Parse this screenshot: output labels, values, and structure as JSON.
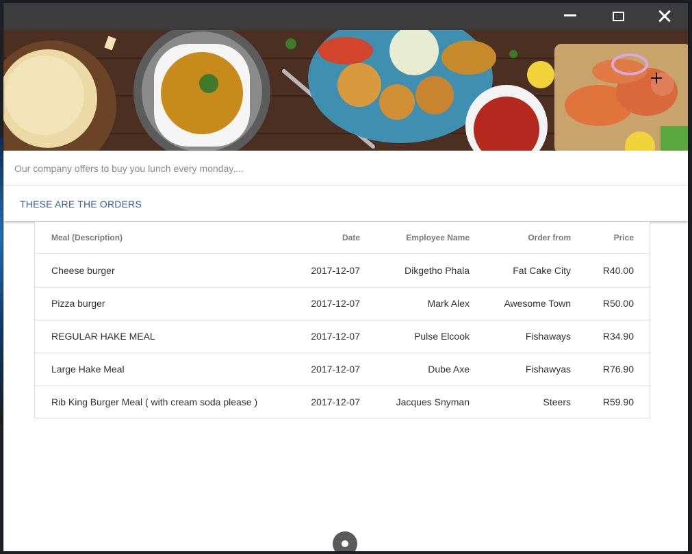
{
  "window": {
    "controls": [
      "minimize-icon",
      "maximize-icon",
      "close-icon"
    ]
  },
  "banner": {
    "add_icon": "plus-icon"
  },
  "intro": {
    "text": "Our company offers to buy you lunch every monday...."
  },
  "orders": {
    "title": "THESE ARE THE ORDERS",
    "columns": [
      "Meal (Description)",
      "Date",
      "Employee Name",
      "Order from",
      "Price"
    ],
    "rows": [
      [
        "Cheese burger",
        "2017-12-07",
        "Dikgetho Phala",
        "Fat Cake City",
        "R40.00"
      ],
      [
        "Pizza burger",
        "2017-12-07",
        "Mark Alex",
        "Awesome Town",
        "R50.00"
      ],
      [
        "REGULAR HAKE MEAL",
        "2017-12-07",
        "Pulse Elcook",
        "Fishaways",
        "R34.90"
      ],
      [
        "Large Hake Meal",
        "2017-12-07",
        "Dube Axe",
        "Fishawyas",
        "R76.90"
      ],
      [
        "Rib King Burger Meal ( with cream soda please )",
        "2017-12-07",
        "Jacques Snyman",
        "Steers",
        "R59.90"
      ]
    ]
  },
  "colors": {
    "titlebar": "#3b3b3b",
    "accent_text": "#3f5aa6",
    "fab": "#5a5a5a"
  }
}
